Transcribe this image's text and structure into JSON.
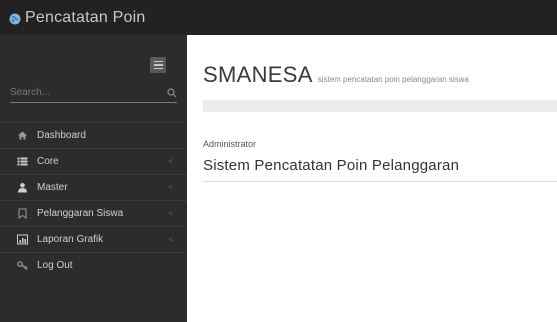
{
  "app": {
    "brand_title": "Pencatatan Poin",
    "accent_color": "#222222",
    "sidebar_color": "#2c2c2c"
  },
  "sidebar": {
    "search_placeholder": "Search...",
    "items": [
      {
        "label": "Dashboard",
        "icon": "home-icon",
        "has_submenu": false
      },
      {
        "label": "Core",
        "icon": "list-icon",
        "has_submenu": true
      },
      {
        "label": "Master",
        "icon": "user-icon",
        "has_submenu": true
      },
      {
        "label": "Pelanggaran Siswa",
        "icon": "bookmark-icon",
        "has_submenu": true
      },
      {
        "label": "Laporan Grafik",
        "icon": "chart-icon",
        "has_submenu": true
      },
      {
        "label": "Log Out",
        "icon": "key-icon",
        "has_submenu": false
      }
    ]
  },
  "main": {
    "title": "SMANESA",
    "subtitle": "sistem pencatatan poin pelanggaran siswa",
    "role": "Administrator",
    "system_title": "Sistem Pencatatan Poin Pelanggaran"
  }
}
